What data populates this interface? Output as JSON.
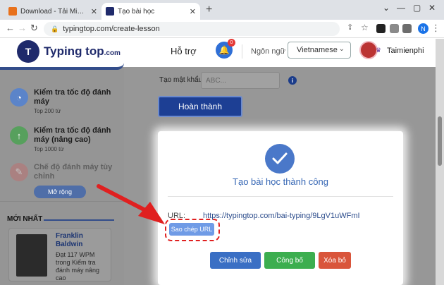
{
  "browser": {
    "tabs": [
      {
        "label": "Download - Tải Miễn Phí VN - Ph",
        "favicon_color": "#e8711c",
        "active": false
      },
      {
        "label": "Tạo bài học",
        "favicon_color": "#1f2a6b",
        "active": true
      }
    ],
    "new_tab_icon": "+",
    "address": "typingtop.com/create-lesson",
    "profile_initial": "N"
  },
  "header": {
    "logo_mark": "T",
    "logo_text": "Typing top",
    "logo_suffix": ".com",
    "support": "Hỗ trợ",
    "notification_count": "0",
    "language_label": "Ngôn ngữ",
    "language_value": "Vietnamese",
    "username": "Taimienphi"
  },
  "sidebar": {
    "items": [
      {
        "title": "Kiểm tra tốc độ đánh máy",
        "sub": "Top 200 từ",
        "icon": "timer-icon",
        "color": "#5b84c9"
      },
      {
        "title": "Kiểm tra tốc độ đánh máy (nâng cao)",
        "sub": "Top 1000 từ",
        "icon": "arrow-up-icon",
        "color": "#57a05d"
      },
      {
        "title": "Chế độ đánh máy tùy chỉnh",
        "sub": "",
        "icon": "custom-icon",
        "color": "#c46a6a"
      }
    ],
    "expand_label": "Mở rộng",
    "latest_heading": "MỚI NHẤT",
    "latest": {
      "name": "Franklin Baldwin",
      "desc": "Đạt 117 WPM trong Kiểm tra đánh máy nâng cao"
    }
  },
  "form": {
    "password_label": "Tạo mật khẩu:",
    "password_placeholder": "ABC...",
    "finish_label": "Hoàn thành"
  },
  "result": {
    "success_text": "Tạo bài học thành công",
    "url_label": "URL:",
    "url_value": "https://typingtop.com/bai-typing/9LgV1uWFmI",
    "copy_label": "Sao chép URL",
    "actions": [
      {
        "label": "Chỉnh sửa",
        "color": "#3a6fc4"
      },
      {
        "label": "Công bố",
        "color": "#3cae4f"
      },
      {
        "label": "Xóa bỏ",
        "color": "#d9553b"
      }
    ]
  },
  "colors": {
    "accent": "#1d3f94",
    "highlight": "#e02020"
  }
}
